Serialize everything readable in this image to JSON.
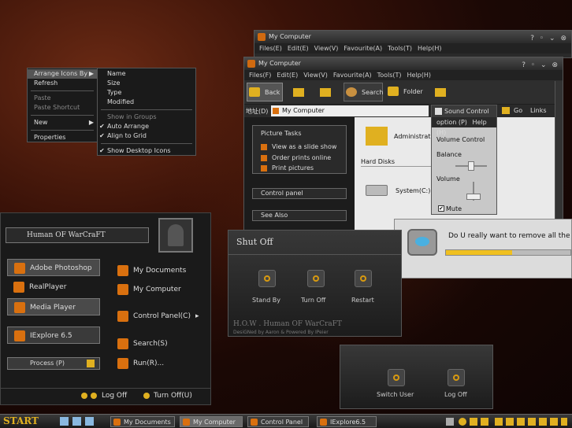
{
  "context_menu": {
    "items": [
      {
        "label": "Arrange Icons By",
        "arrow": "▶"
      },
      {
        "label": "Refresh"
      },
      {
        "label": "Paste"
      },
      {
        "label": "Paste Shortcut"
      },
      {
        "label": "New",
        "arrow": "▶"
      },
      {
        "label": "Properties"
      }
    ],
    "submenu": [
      "Name",
      "Size",
      "Type",
      "Modified",
      "Show in Groups",
      "Auto Arrange",
      "Align to Grid",
      "Show Desktop Icons"
    ]
  },
  "window_back": {
    "title": "My Computer",
    "menu": [
      "Files(E)",
      "Edit(E)",
      "View(V)",
      "Favourite(A)",
      "Tools(T)",
      "Help(H)"
    ],
    "controls": "? ◦ ⌄ ⊗"
  },
  "window_front": {
    "title": "My Computer",
    "menu": [
      "Files(F)",
      "Edit(E)",
      "View(V)",
      "Favourite(A)",
      "Tools(T)",
      "Help(H)"
    ],
    "controls": "? ◦ ⌄ ⊗",
    "toolbar": {
      "back": "Back",
      "search": "Search",
      "folder": "Folder"
    },
    "address_label": "地址(D)",
    "address_value": "My Computer",
    "go": "Go",
    "links": "Links",
    "picture_tasks": {
      "title": "Picture Tasks",
      "items": [
        "View as a slide show",
        "Order prints online",
        "Print pictures"
      ]
    },
    "control_panel": "Control panel",
    "see_also": "See Also",
    "admin": "Administrat",
    "hard_disks": "Hard Disks",
    "system_drive": "System(C:)"
  },
  "sound_control": {
    "title": "Sound Control",
    "menu": [
      "option (P)",
      "Help (H)"
    ],
    "heading": "Volume Control",
    "balance": "Balance",
    "volume": "Volume",
    "mute": "Mute",
    "balance_level": 0.5,
    "volume_level": 0.2
  },
  "dialog": {
    "message": "Do U really want to remove all the fo",
    "progress": 0.53
  },
  "shut_off": {
    "title": "Shut Off",
    "buttons": [
      "Stand By",
      "Turn Off",
      "Restart"
    ],
    "footer1": "H.O.W . Human OF WarCraFT",
    "footer2": "DesiGNed by Aaron & Powered By IPeier"
  },
  "logoff_panel": {
    "buttons": [
      "Switch User",
      "Log Off"
    ]
  },
  "start_menu": {
    "user": "Human OF WarCraFT",
    "left": [
      "Adobe Photoshop",
      "RealPlayer",
      "Media Player",
      "IExplore 6.5"
    ],
    "process": "Process (P)",
    "right": [
      "My Documents",
      "My Computer",
      "Control Panel(C)",
      "Search(S)",
      "Run(R)..."
    ],
    "logoff": "Log Off",
    "turnoff": "Turn Off(U)"
  },
  "taskbar": {
    "start": "START",
    "tasks": [
      "My Documents",
      "My Computer",
      "Control Panel",
      "IExplore6.5"
    ]
  },
  "colors": {
    "accent": "#d9700f",
    "gold": "#e0b020",
    "progress": "#f0c020"
  }
}
